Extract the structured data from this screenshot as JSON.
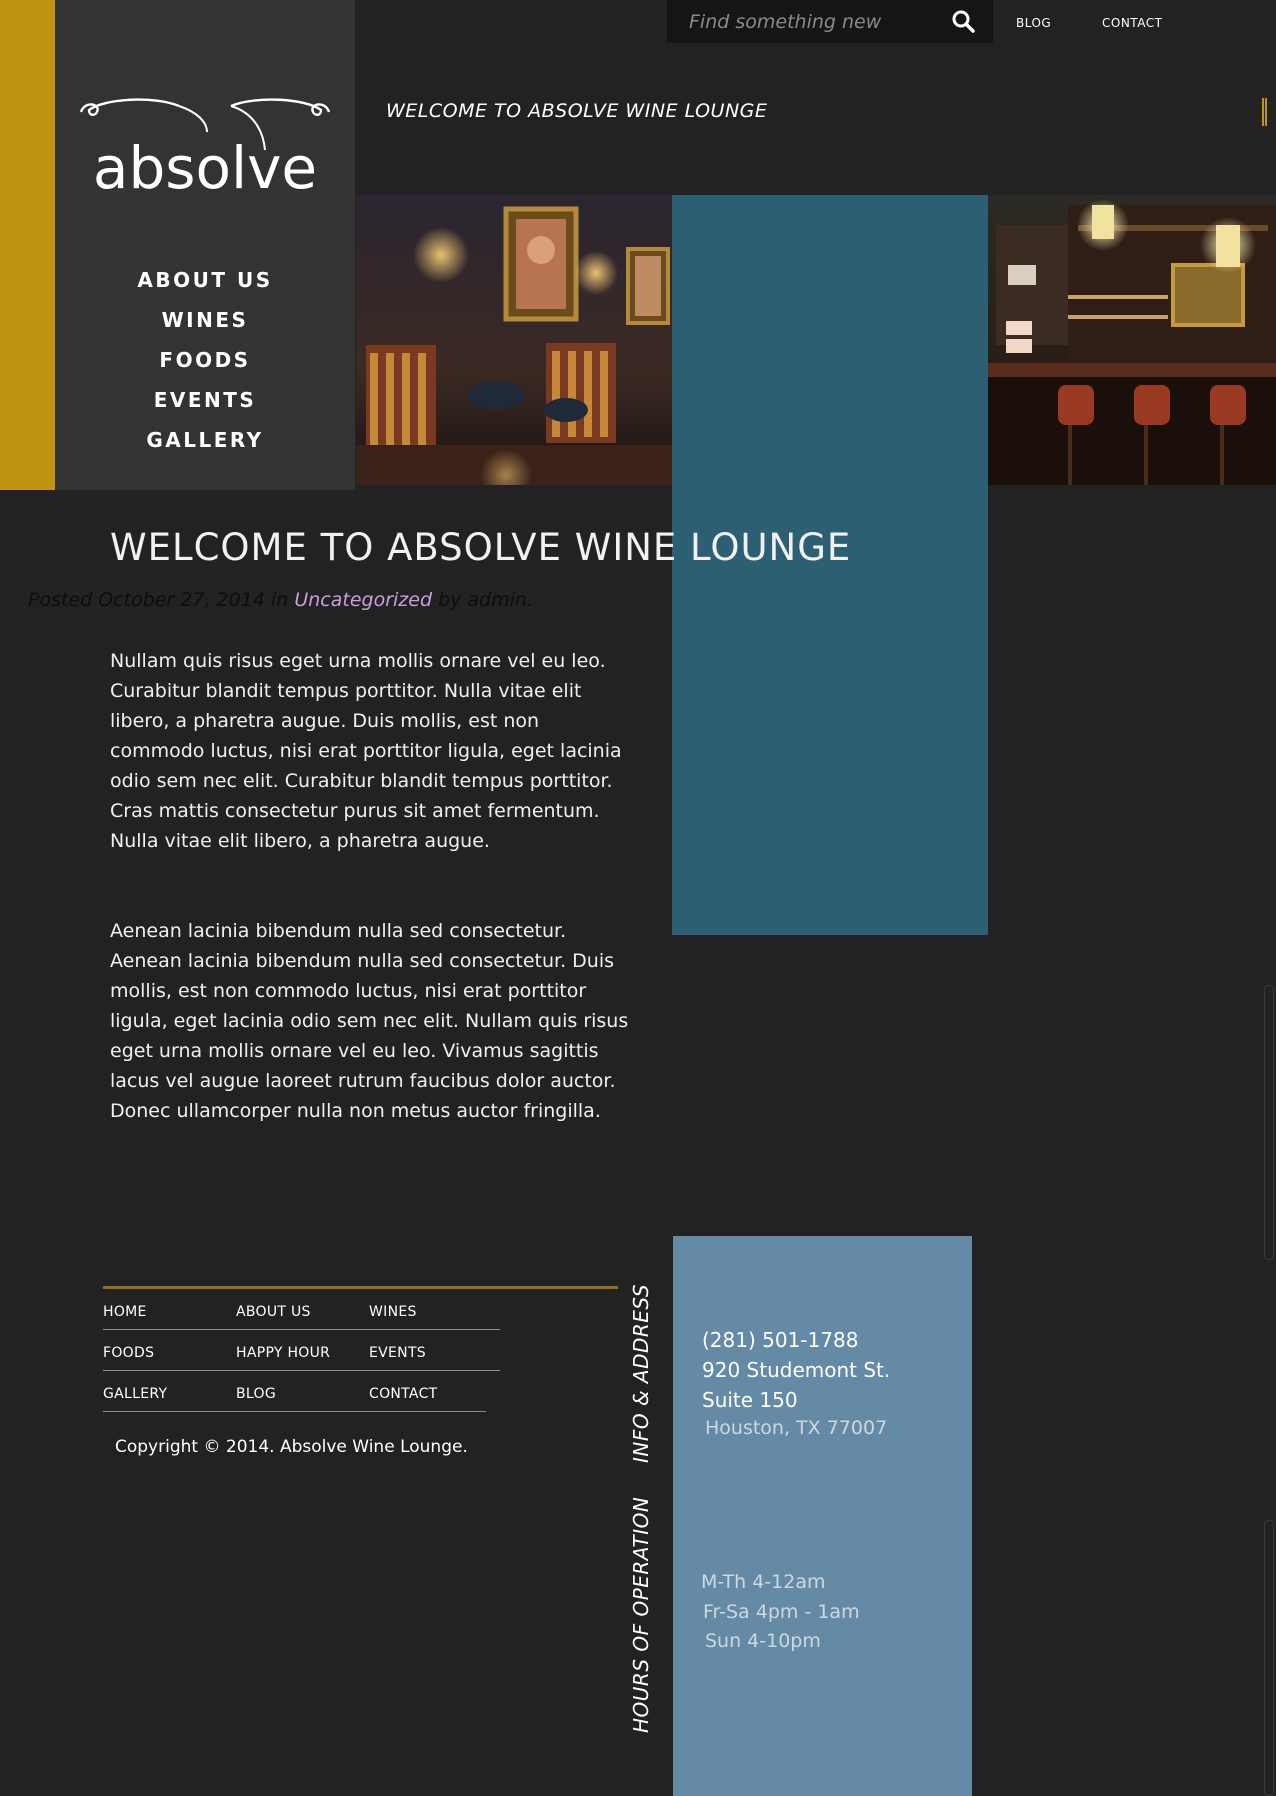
{
  "brand": {
    "logo_text": "absolve"
  },
  "colors": {
    "gold": "#bd9513",
    "sidebar": "#333333",
    "teal": "#2d5f73",
    "steel_blue": "#648aa5",
    "link": "#c9a0dc"
  },
  "search": {
    "placeholder": "Find something new",
    "icon": "search-icon"
  },
  "top_nav": {
    "blog": "BLOG",
    "contact": "CONTACT"
  },
  "header_title": "WELCOME TO ABSOLVE WINE LOUNGE",
  "main_nav": [
    "ABOUT US",
    "WINES",
    "FOODS",
    "EVENTS",
    "GALLERY"
  ],
  "post": {
    "title": "WELCOME TO ABSOLVE WINE LOUNGE",
    "meta": {
      "posted": "Posted October 27, 2014 in",
      "category": "Uncategorized",
      "by": "by admin."
    },
    "paragraphs": [
      "Nullam quis risus eget urna mollis ornare vel eu leo. Curabitur blandit tempus porttitor. Nulla vitae elit libero, a pharetra augue. Duis mollis, est non commodo luctus, nisi erat porttitor ligula, eget lacinia odio sem nec elit. Curabitur blandit tempus porttitor. Cras mattis consectetur purus sit amet fermentum. Nulla vitae elit libero, a pharetra augue.",
      "Aenean lacinia bibendum nulla sed consectetur. Aenean lacinia bibendum nulla sed consectetur. Duis mollis, est non commodo luctus, nisi erat porttitor ligula, eget lacinia odio sem nec elit. Nullam quis risus eget urna mollis ornare vel eu leo. Vivamus sagittis lacus vel augue laoreet rutrum faucibus dolor auctor. Donec ullamcorper nulla non metus auctor fringilla."
    ]
  },
  "footer": {
    "nav": [
      [
        "HOME",
        "ABOUT US",
        "WINES"
      ],
      [
        "FOODS",
        "HAPPY HOUR",
        "EVENTS"
      ],
      [
        "GALLERY",
        "BLOG",
        "CONTACT"
      ]
    ],
    "copyright": "Copyright © 2014. Absolve Wine Lounge.",
    "info_label": "INFO & ADDRESS",
    "hours_label": "HOURS OF OPERATION",
    "phone": "(281) 501-1788",
    "address_1": "920 Studemont St.",
    "address_2": "Suite 150",
    "city": "Houston, TX 77007",
    "hours": [
      "M-Th 4-12am",
      "Fr-Sa 4pm - 1am",
      "Sun 4-10pm"
    ]
  }
}
